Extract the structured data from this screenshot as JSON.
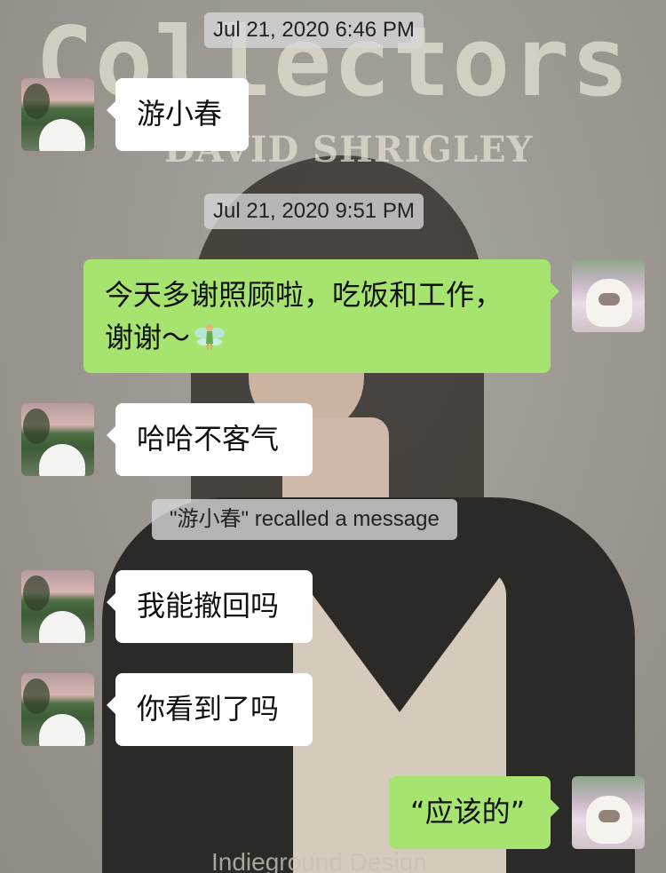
{
  "wallpaper": {
    "title": "Collectors",
    "subtitle": "DAVID SHRIGLEY",
    "footer": "Indieground Design"
  },
  "messages": [
    {
      "type": "timestamp",
      "text": "Jul 21, 2020 6:46 PM"
    },
    {
      "type": "incoming",
      "text": "游小春"
    },
    {
      "type": "timestamp",
      "text": "Jul 21, 2020 9:51 PM"
    },
    {
      "type": "outgoing",
      "line1": "今天多谢照顾啦，吃饭和工作，",
      "line2": "谢谢～",
      "emoji": "fairy-emoji"
    },
    {
      "type": "incoming",
      "text": "哈哈不客气"
    },
    {
      "type": "system",
      "text": "\"游小春\" recalled a message"
    },
    {
      "type": "incoming",
      "text": "我能撤回吗"
    },
    {
      "type": "incoming",
      "text": "你看到了吗"
    },
    {
      "type": "outgoing",
      "text": "“应该的”"
    }
  ],
  "colors": {
    "incoming_bubble": "#ffffff",
    "outgoing_bubble": "#a6e46f",
    "timestamp_bg": "#d7d7d7"
  }
}
